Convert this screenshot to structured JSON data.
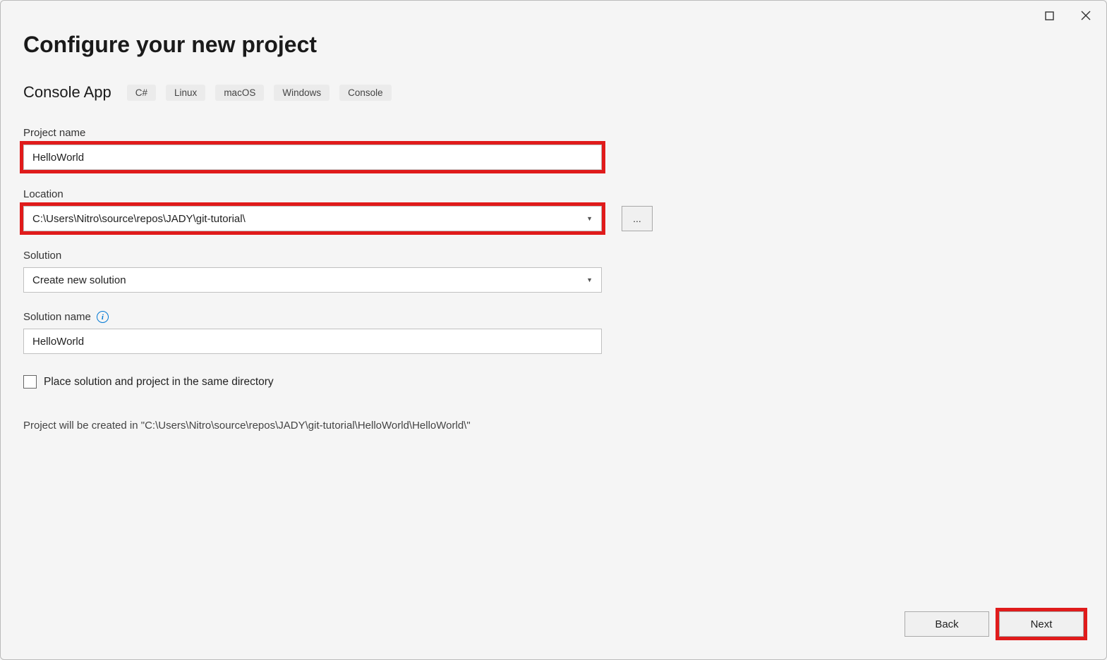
{
  "window": {
    "maximize_name": "maximize",
    "close_name": "close"
  },
  "header": {
    "title": "Configure your new project",
    "template_name": "Console App",
    "tags": [
      "C#",
      "Linux",
      "macOS",
      "Windows",
      "Console"
    ]
  },
  "fields": {
    "project_name": {
      "label": "Project name",
      "value": "HelloWorld"
    },
    "location": {
      "label": "Location",
      "value": "C:\\Users\\Nitro\\source\\repos\\JADY\\git-tutorial\\",
      "browse_label": "..."
    },
    "solution": {
      "label": "Solution",
      "value": "Create new solution"
    },
    "solution_name": {
      "label": "Solution name",
      "value": "HelloWorld"
    },
    "same_directory": {
      "label": "Place solution and project in the same directory",
      "checked": false
    }
  },
  "path_note": "Project will be created in \"C:\\Users\\Nitro\\source\\repos\\JADY\\git-tutorial\\HelloWorld\\HelloWorld\\\"",
  "footer": {
    "back_label": "Back",
    "next_label": "Next"
  }
}
